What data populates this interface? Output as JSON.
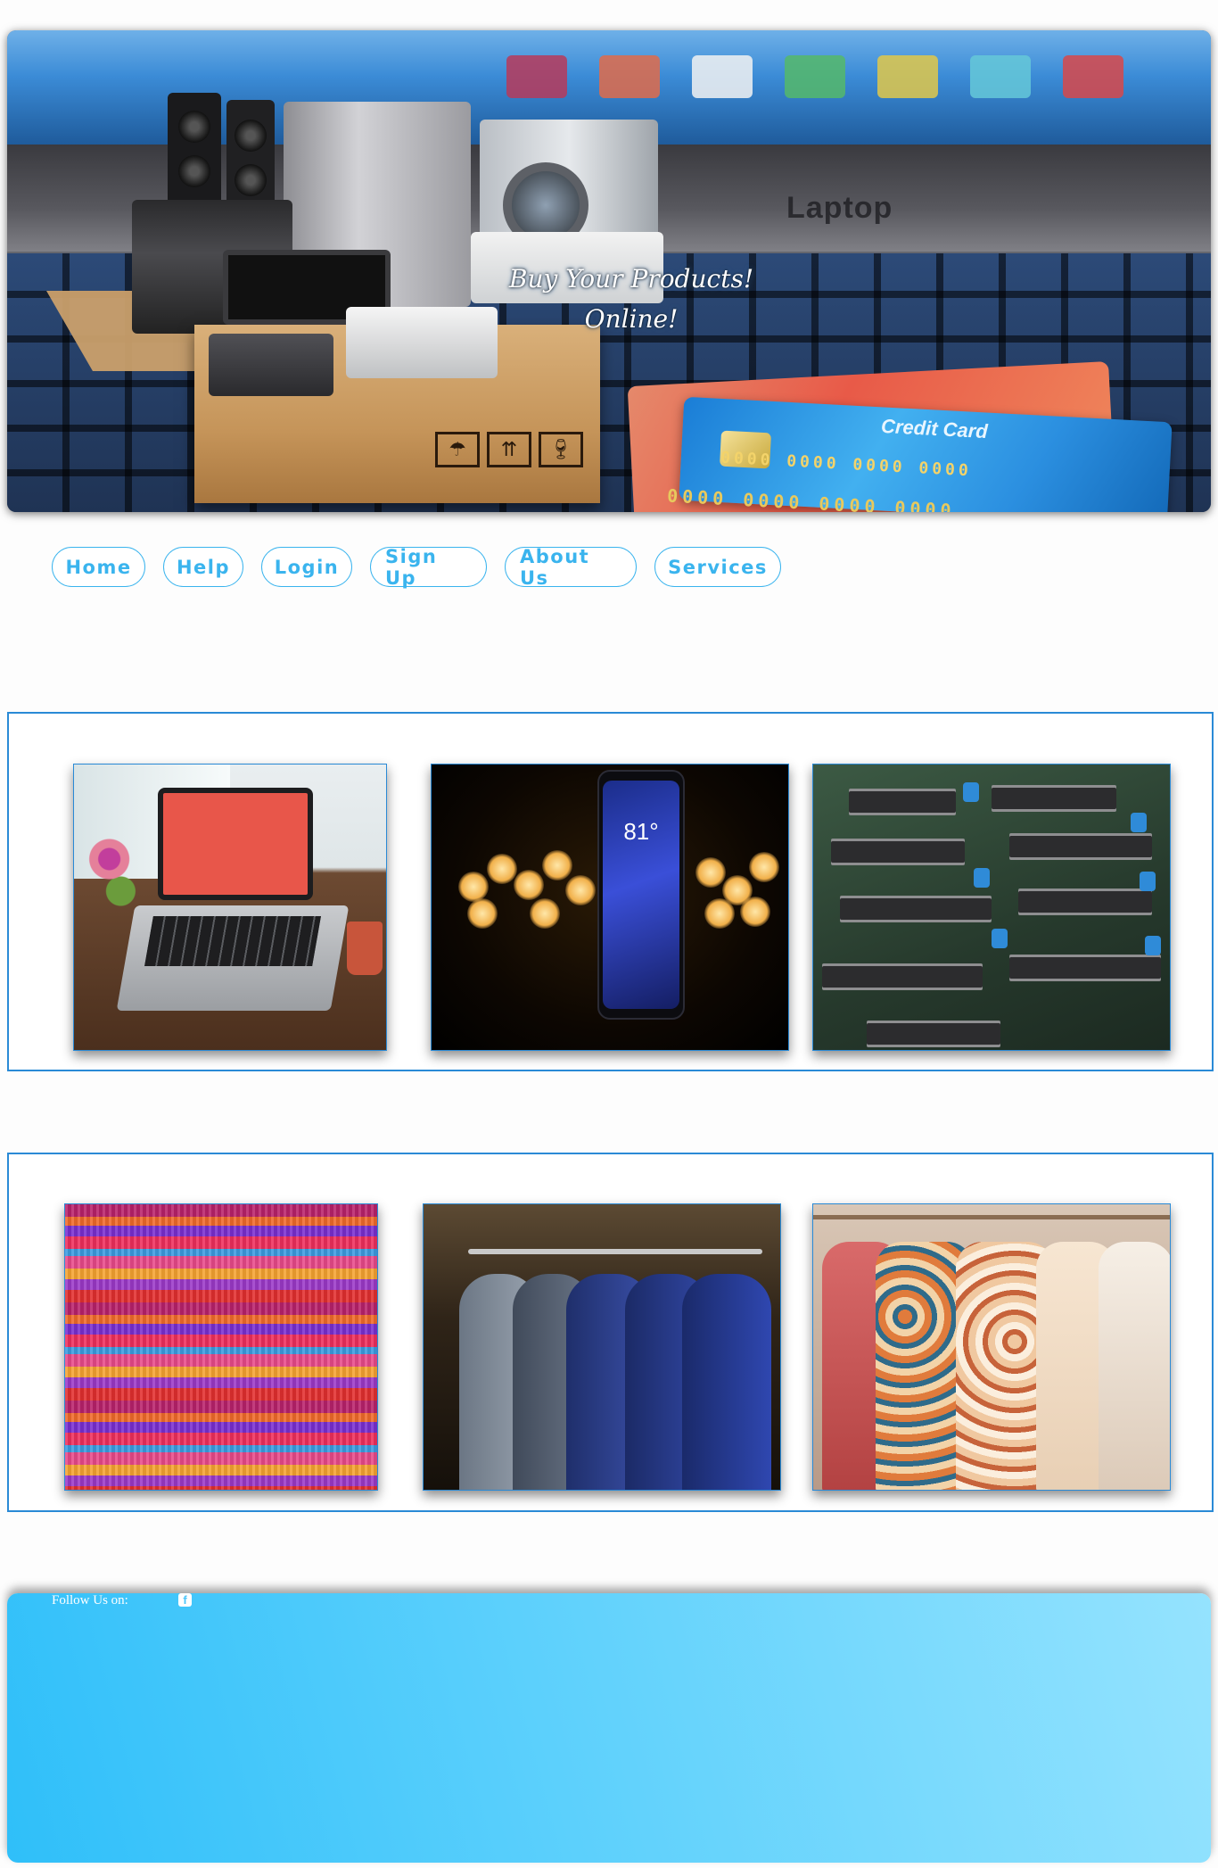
{
  "hero": {
    "tagline_line1": "Buy Your Products!",
    "tagline_line2": "Online!",
    "laptop_brand": "Laptop",
    "card_title": "Credit Card",
    "card_number": "0000 0000 0000 0000",
    "card_number_back": "0000 0000 0000 0000"
  },
  "nav": {
    "items": [
      {
        "label": "Home"
      },
      {
        "label": "Help"
      },
      {
        "label": "Login"
      },
      {
        "label": "Sign Up"
      },
      {
        "label": "About Us"
      },
      {
        "label": "Services"
      }
    ]
  },
  "gallery_1": {
    "images": [
      "laptop on wooden desk",
      "smartphone with bokeh lights",
      "circuit board chips"
    ],
    "phone_clock": "81°"
  },
  "gallery_2": {
    "images": [
      "stacked colorful fabrics",
      "suits on clothing rail",
      "patterned dresses on hangers"
    ]
  },
  "footer": {
    "follow_label": "Follow Us on:",
    "facebook_icon": "facebook-icon",
    "facebook_glyph": "f"
  },
  "colors": {
    "accent": "#3ab4ee",
    "section_border": "#2a8ad6",
    "footer_start": "#2fbff9",
    "footer_end": "#95e3fe"
  }
}
